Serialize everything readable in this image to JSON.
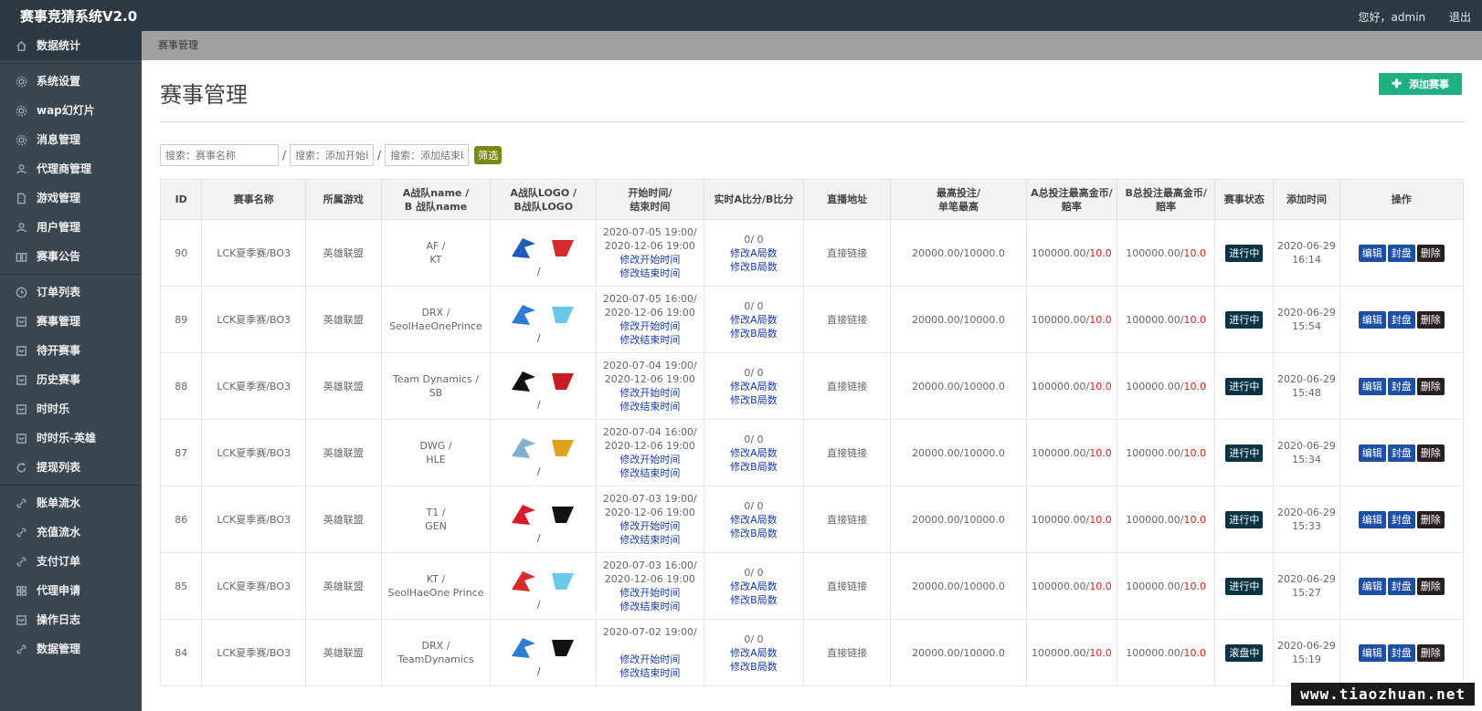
{
  "app": {
    "title": "赛事竞猜系统V2.0",
    "greeting": "您好，admin",
    "logout": "退出"
  },
  "sidebar": {
    "items": [
      {
        "label": "数据统计",
        "icon": "home-icon"
      },
      {
        "label": "系统设置",
        "icon": "gear-icon"
      },
      {
        "label": "wap幻灯片",
        "icon": "gear-icon"
      },
      {
        "label": "消息管理",
        "icon": "gear-icon"
      },
      {
        "label": "代理商管理",
        "icon": "user-icon"
      },
      {
        "label": "游戏管理",
        "icon": "file-icon"
      },
      {
        "label": "用户管理",
        "icon": "user-icon"
      },
      {
        "label": "赛事公告",
        "icon": "book-icon"
      },
      {
        "label": "订单列表",
        "icon": "clock-icon"
      },
      {
        "label": "赛事管理",
        "icon": "square-icon"
      },
      {
        "label": "待开赛事",
        "icon": "square-icon"
      },
      {
        "label": "历史赛事",
        "icon": "square-icon"
      },
      {
        "label": "时时乐",
        "icon": "square-icon"
      },
      {
        "label": "时时乐-英雄",
        "icon": "square-icon"
      },
      {
        "label": "提现列表",
        "icon": "refresh-icon"
      },
      {
        "label": "账单流水",
        "icon": "link-icon"
      },
      {
        "label": "充值流水",
        "icon": "link-icon"
      },
      {
        "label": "支付订单",
        "icon": "link-icon"
      },
      {
        "label": "代理申请",
        "icon": "grid-icon"
      },
      {
        "label": "操作日志",
        "icon": "square-icon"
      },
      {
        "label": "数据管理",
        "icon": "link-icon"
      }
    ]
  },
  "breadcrumb": "赛事管理",
  "page": {
    "title": "赛事管理",
    "add_button": "添加赛事"
  },
  "search": {
    "name_placeholder": "搜索：赛事名称",
    "start_placeholder": "搜索：添加开始时间",
    "end_placeholder": "搜索：添加结束时间",
    "filter_button": "筛选"
  },
  "table": {
    "headers": [
      "ID",
      "赛事名称",
      "所属游戏",
      "A战队name /\nB 战队name",
      "A战队LOGO /\nB战队LOGO",
      "开始时间/\n结束时间",
      "实时A比分/B比分",
      "直播地址",
      "最高投注/\n单笔最高",
      "A总投注最高金币/\n赔率",
      "B总投注最高金币/\n赔率",
      "赛事状态",
      "添加时间",
      "操作"
    ],
    "links": {
      "edit_start": "修改开始时间",
      "edit_end": "修改结束时间",
      "edit_a": "修改A局数",
      "edit_b": "修改B局数",
      "stream": "直接链接"
    },
    "ops": {
      "edit": "编辑",
      "seal": "封盘",
      "delete": "删除"
    },
    "rows": [
      {
        "id": "90",
        "name": "LCK夏季赛/BO3",
        "game": "英雄联盟",
        "team_a": "AF /",
        "team_b": "KT",
        "start": "2020-07-05 19:00/",
        "end": "2020-12-06 19:00",
        "score": "0/ 0",
        "bet": "20000.00/10000.0",
        "a_total": "100000.00/",
        "a_odds": "10.0",
        "b_total": "100000.00/",
        "b_odds": "10.0",
        "status": "进行中",
        "added_date": "2020-06-29",
        "added_time": "16:14"
      },
      {
        "id": "89",
        "name": "LCK夏季赛/BO3",
        "game": "英雄联盟",
        "team_a": "DRX /",
        "team_b": "SeolHaeOnePrince",
        "start": "2020-07-05 16:00/",
        "end": "2020-12-06 19:00",
        "score": "0/ 0",
        "bet": "20000.00/10000.0",
        "a_total": "100000.00/",
        "a_odds": "10.0",
        "b_total": "100000.00/",
        "b_odds": "10.0",
        "status": "进行中",
        "added_date": "2020-06-29",
        "added_time": "15:54"
      },
      {
        "id": "88",
        "name": "LCK夏季赛/BO3",
        "game": "英雄联盟",
        "team_a": "Team Dynamics /",
        "team_b": "SB",
        "start": "2020-07-04 19:00/",
        "end": "2020-12-06 19:00",
        "score": "0/ 0",
        "bet": "20000.00/10000.0",
        "a_total": "100000.00/",
        "a_odds": "10.0",
        "b_total": "100000.00/",
        "b_odds": "10.0",
        "status": "进行中",
        "added_date": "2020-06-29",
        "added_time": "15:48"
      },
      {
        "id": "87",
        "name": "LCK夏季赛/BO3",
        "game": "英雄联盟",
        "team_a": "DWG /",
        "team_b": "HLE",
        "start": "2020-07-04 16:00/",
        "end": "2020-12-06 19:00",
        "score": "0/ 0",
        "bet": "20000.00/10000.0",
        "a_total": "100000.00/",
        "a_odds": "10.0",
        "b_total": "100000.00/",
        "b_odds": "10.0",
        "status": "进行中",
        "added_date": "2020-06-29",
        "added_time": "15:34"
      },
      {
        "id": "86",
        "name": "LCK夏季赛/BO3",
        "game": "英雄联盟",
        "team_a": "T1 /",
        "team_b": "GEN",
        "start": "2020-07-03 19:00/",
        "end": "2020-12-06 19:00",
        "score": "0/ 0",
        "bet": "20000.00/10000.0",
        "a_total": "100000.00/",
        "a_odds": "10.0",
        "b_total": "100000.00/",
        "b_odds": "10.0",
        "status": "进行中",
        "added_date": "2020-06-29",
        "added_time": "15:33"
      },
      {
        "id": "85",
        "name": "LCK夏季赛/BO3",
        "game": "英雄联盟",
        "team_a": "KT /",
        "team_b": "SeolHaeOne Prince",
        "start": "2020-07-03 16:00/",
        "end": "2020-12-06 19:00",
        "score": "0/ 0",
        "bet": "20000.00/10000.0",
        "a_total": "100000.00/",
        "a_odds": "10.0",
        "b_total": "100000.00/",
        "b_odds": "10.0",
        "status": "进行中",
        "added_date": "2020-06-29",
        "added_time": "15:27"
      },
      {
        "id": "84",
        "name": "LCK夏季赛/BO3",
        "game": "英雄联盟",
        "team_a": "DRX /",
        "team_b": "TeamDynamics",
        "start": "2020-07-02 19:00/",
        "end": "",
        "score": "0/ 0",
        "bet": "20000.00/10000.0",
        "a_total": "100000.00/",
        "a_odds": "10.0",
        "b_total": "100000.00/",
        "b_odds": "10.0",
        "status": "滚盘中",
        "added_date": "2020-06-29",
        "added_time": "15:19"
      }
    ]
  },
  "watermark": "www.tiaozhuan.net"
}
